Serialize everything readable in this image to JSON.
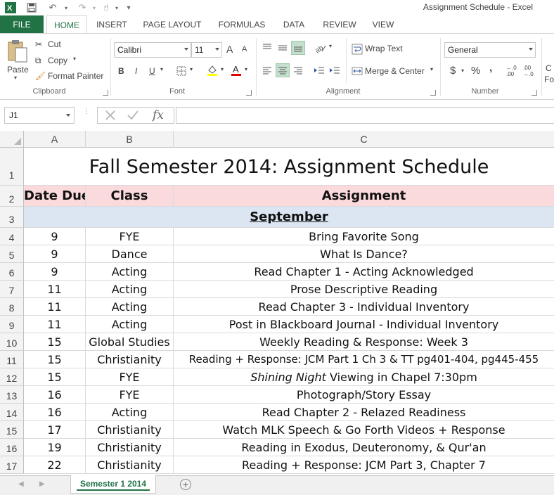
{
  "window": {
    "title": "Assignment Schedule - Excel"
  },
  "ribbon": {
    "tabs": [
      "FILE",
      "HOME",
      "INSERT",
      "PAGE LAYOUT",
      "FORMULAS",
      "DATA",
      "REVIEW",
      "VIEW"
    ],
    "active_tab": "HOME",
    "clipboard": {
      "paste": "Paste",
      "cut": "Cut",
      "copy": "Copy",
      "format_painter": "Format Painter",
      "label": "Clipboard"
    },
    "font": {
      "name": "Calibri",
      "size": "11",
      "label": "Font",
      "bold": "B",
      "italic": "I",
      "underline": "U",
      "grow": "A",
      "shrink": "A"
    },
    "alignment": {
      "wrap_text": "Wrap Text",
      "merge_center": "Merge & Center",
      "label": "Alignment"
    },
    "number": {
      "format": "General",
      "currency": "$",
      "percent": "%",
      "comma": ",",
      "inc_decimal": "←.0 .00",
      "dec_decimal": ".00 →.0",
      "label": "Number"
    },
    "styles_partial": {
      "line1": "C",
      "line2": "Fo"
    }
  },
  "formula_bar": {
    "name_box": "J1",
    "fx": "fx",
    "value": ""
  },
  "grid": {
    "columns": [
      "A",
      "B",
      "C"
    ],
    "title": "Fall Semester 2014: Assignment Schedule",
    "headers": [
      "Date Due",
      "Class",
      "Assignment"
    ],
    "month": "September",
    "rows": [
      {
        "row": "4",
        "date": "9",
        "class": "FYE",
        "assignment": "Bring Favorite Song"
      },
      {
        "row": "5",
        "date": "9",
        "class": "Dance",
        "assignment": "What Is Dance?"
      },
      {
        "row": "6",
        "date": "9",
        "class": "Acting",
        "assignment": "Read Chapter 1 - Acting Acknowledged"
      },
      {
        "row": "7",
        "date": "11",
        "class": "Acting",
        "assignment": "Prose Descriptive Reading"
      },
      {
        "row": "8",
        "date": "11",
        "class": "Acting",
        "assignment": "Read Chapter 3 - Individual Inventory"
      },
      {
        "row": "9",
        "date": "11",
        "class": "Acting",
        "assignment": "Post in Blackboard Journal - Individual Inventory"
      },
      {
        "row": "10",
        "date": "15",
        "class": "Global Studies",
        "assignment": "Weekly Reading & Response: Week 3"
      },
      {
        "row": "11",
        "date": "15",
        "class": "Christianity",
        "assignment": "Reading + Response: JCM Part 1 Ch 3 & TT pg401-404, pg445-455"
      },
      {
        "row": "12",
        "date": "15",
        "class": "FYE",
        "assignment_italic": "Shining Night",
        "assignment": " Viewing in Chapel 7:30pm"
      },
      {
        "row": "13",
        "date": "16",
        "class": "FYE",
        "assignment": "Photograph/Story Essay"
      },
      {
        "row": "14",
        "date": "16",
        "class": "Acting",
        "assignment": "Read Chapter 2 - Relazed Readiness"
      },
      {
        "row": "15",
        "date": "17",
        "class": "Christianity",
        "assignment": "Watch MLK Speech & Go Forth Videos + Response"
      },
      {
        "row": "16",
        "date": "19",
        "class": "Christianity",
        "assignment": "Reading in Exodus, Deuteronomy, & Qur'an"
      },
      {
        "row": "17",
        "date": "22",
        "class": "Christianity",
        "assignment": "Reading + Response: JCM Part 3, Chapter 7"
      }
    ],
    "row_numbers_top": [
      "1",
      "2",
      "3"
    ]
  },
  "sheets": {
    "active": "Semester 1 2014",
    "add": "+"
  },
  "colors": {
    "excel_green": "#217346",
    "header_pink": "#fadadd",
    "month_blue": "#dce6f2"
  }
}
